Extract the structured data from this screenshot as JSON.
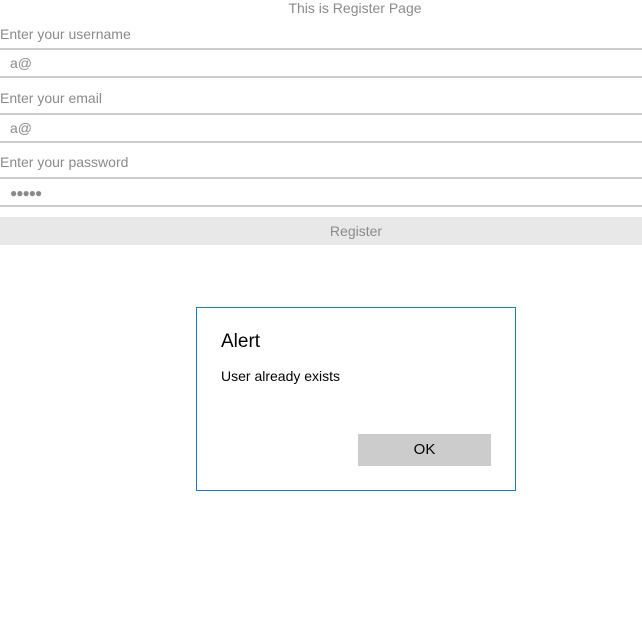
{
  "page": {
    "title": "This is Register Page"
  },
  "form": {
    "username_label": "Enter your username",
    "username_value": "a@",
    "email_label": "Enter your email",
    "email_value": "a@",
    "password_label": "Enter your password",
    "password_value": "●●●●●",
    "register_label": "Register"
  },
  "dialog": {
    "title": "Alert",
    "message": "User already exists",
    "ok_label": "OK",
    "border_color": "#1a7ac4"
  }
}
